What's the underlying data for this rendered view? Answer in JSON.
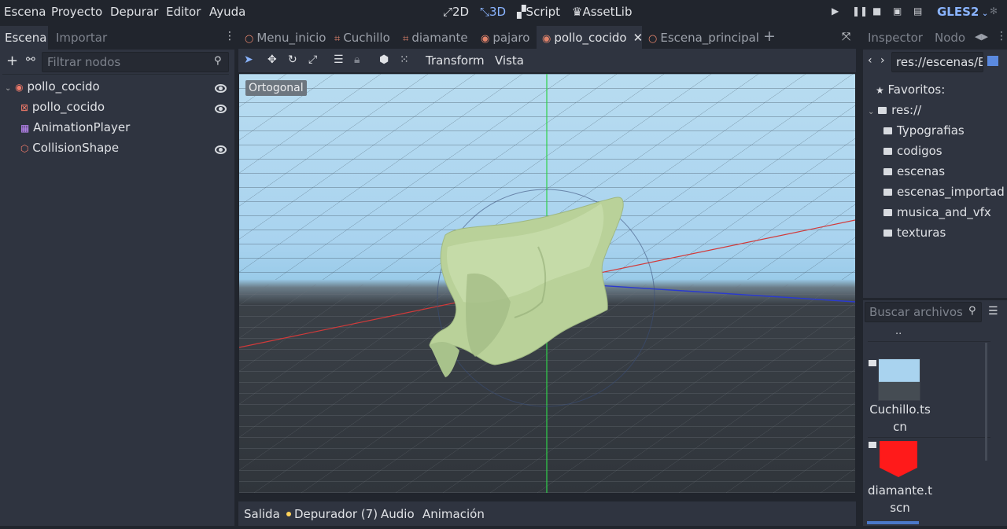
{
  "menu": [
    "Escena",
    "Proyecto",
    "Depurar",
    "Editor",
    "Ayuda"
  ],
  "workspaces": [
    {
      "label": "2D",
      "icon": "2d-icon",
      "active": false
    },
    {
      "label": "3D",
      "icon": "3d-icon",
      "active": true
    },
    {
      "label": "Script",
      "icon": "script-icon",
      "active": false
    },
    {
      "label": "AssetLib",
      "icon": "assetlib-icon",
      "active": false
    }
  ],
  "renderer": "GLES2",
  "scene_dock": {
    "tabs": [
      "Escena",
      "Importar"
    ],
    "filter_placeholder": "Filtrar nodos",
    "nodes": [
      {
        "label": "pollo_cocido",
        "icon": "rigidbody-icon",
        "visible": true
      },
      {
        "label": "pollo_cocido",
        "icon": "mesh-icon",
        "visible": true
      },
      {
        "label": "AnimationPlayer",
        "icon": "animation-player-icon",
        "visible": false
      },
      {
        "label": "CollisionShape",
        "icon": "collision-shape-icon",
        "visible": true
      }
    ]
  },
  "scene_tabs": [
    {
      "label": "Menu_inicio",
      "icon": "node-icon"
    },
    {
      "label": "Cuchillo",
      "icon": "spatial-icon"
    },
    {
      "label": "diamante",
      "icon": "spatial-icon"
    },
    {
      "label": "pajaro",
      "icon": "rigidbody-icon"
    },
    {
      "label": "pollo_cocido",
      "icon": "rigidbody-icon",
      "active": true
    },
    {
      "label": "Escena_principal",
      "icon": "node-icon"
    }
  ],
  "viewport_toolbar": {
    "transform": "Transform",
    "view": "Vista"
  },
  "viewport": {
    "projection_label": "Ortogonal"
  },
  "bottom_tabs": [
    "Salida",
    "Depurador (7)",
    "Audio",
    "Animación"
  ],
  "right_dock": {
    "tabs": [
      "Inspector",
      "Nodo"
    ],
    "path": "res://escenas/E",
    "favorites": "Favoritos:",
    "root": "res://",
    "folders": [
      "Typografias",
      "codigos",
      "escenas",
      "escenas_importad",
      "musica_and_vfx",
      "texturas"
    ],
    "search_placeholder": "Buscar archivos",
    "parent": "..",
    "files": [
      {
        "line1": "Cuchillo.ts",
        "line2": "cn"
      },
      {
        "line1": "diamante.t",
        "line2": "scn"
      }
    ]
  },
  "colors": {
    "accent": "#8ab4ff",
    "panel": "#2f3440",
    "background": "#21252d",
    "gem": "#ff1a1a"
  }
}
